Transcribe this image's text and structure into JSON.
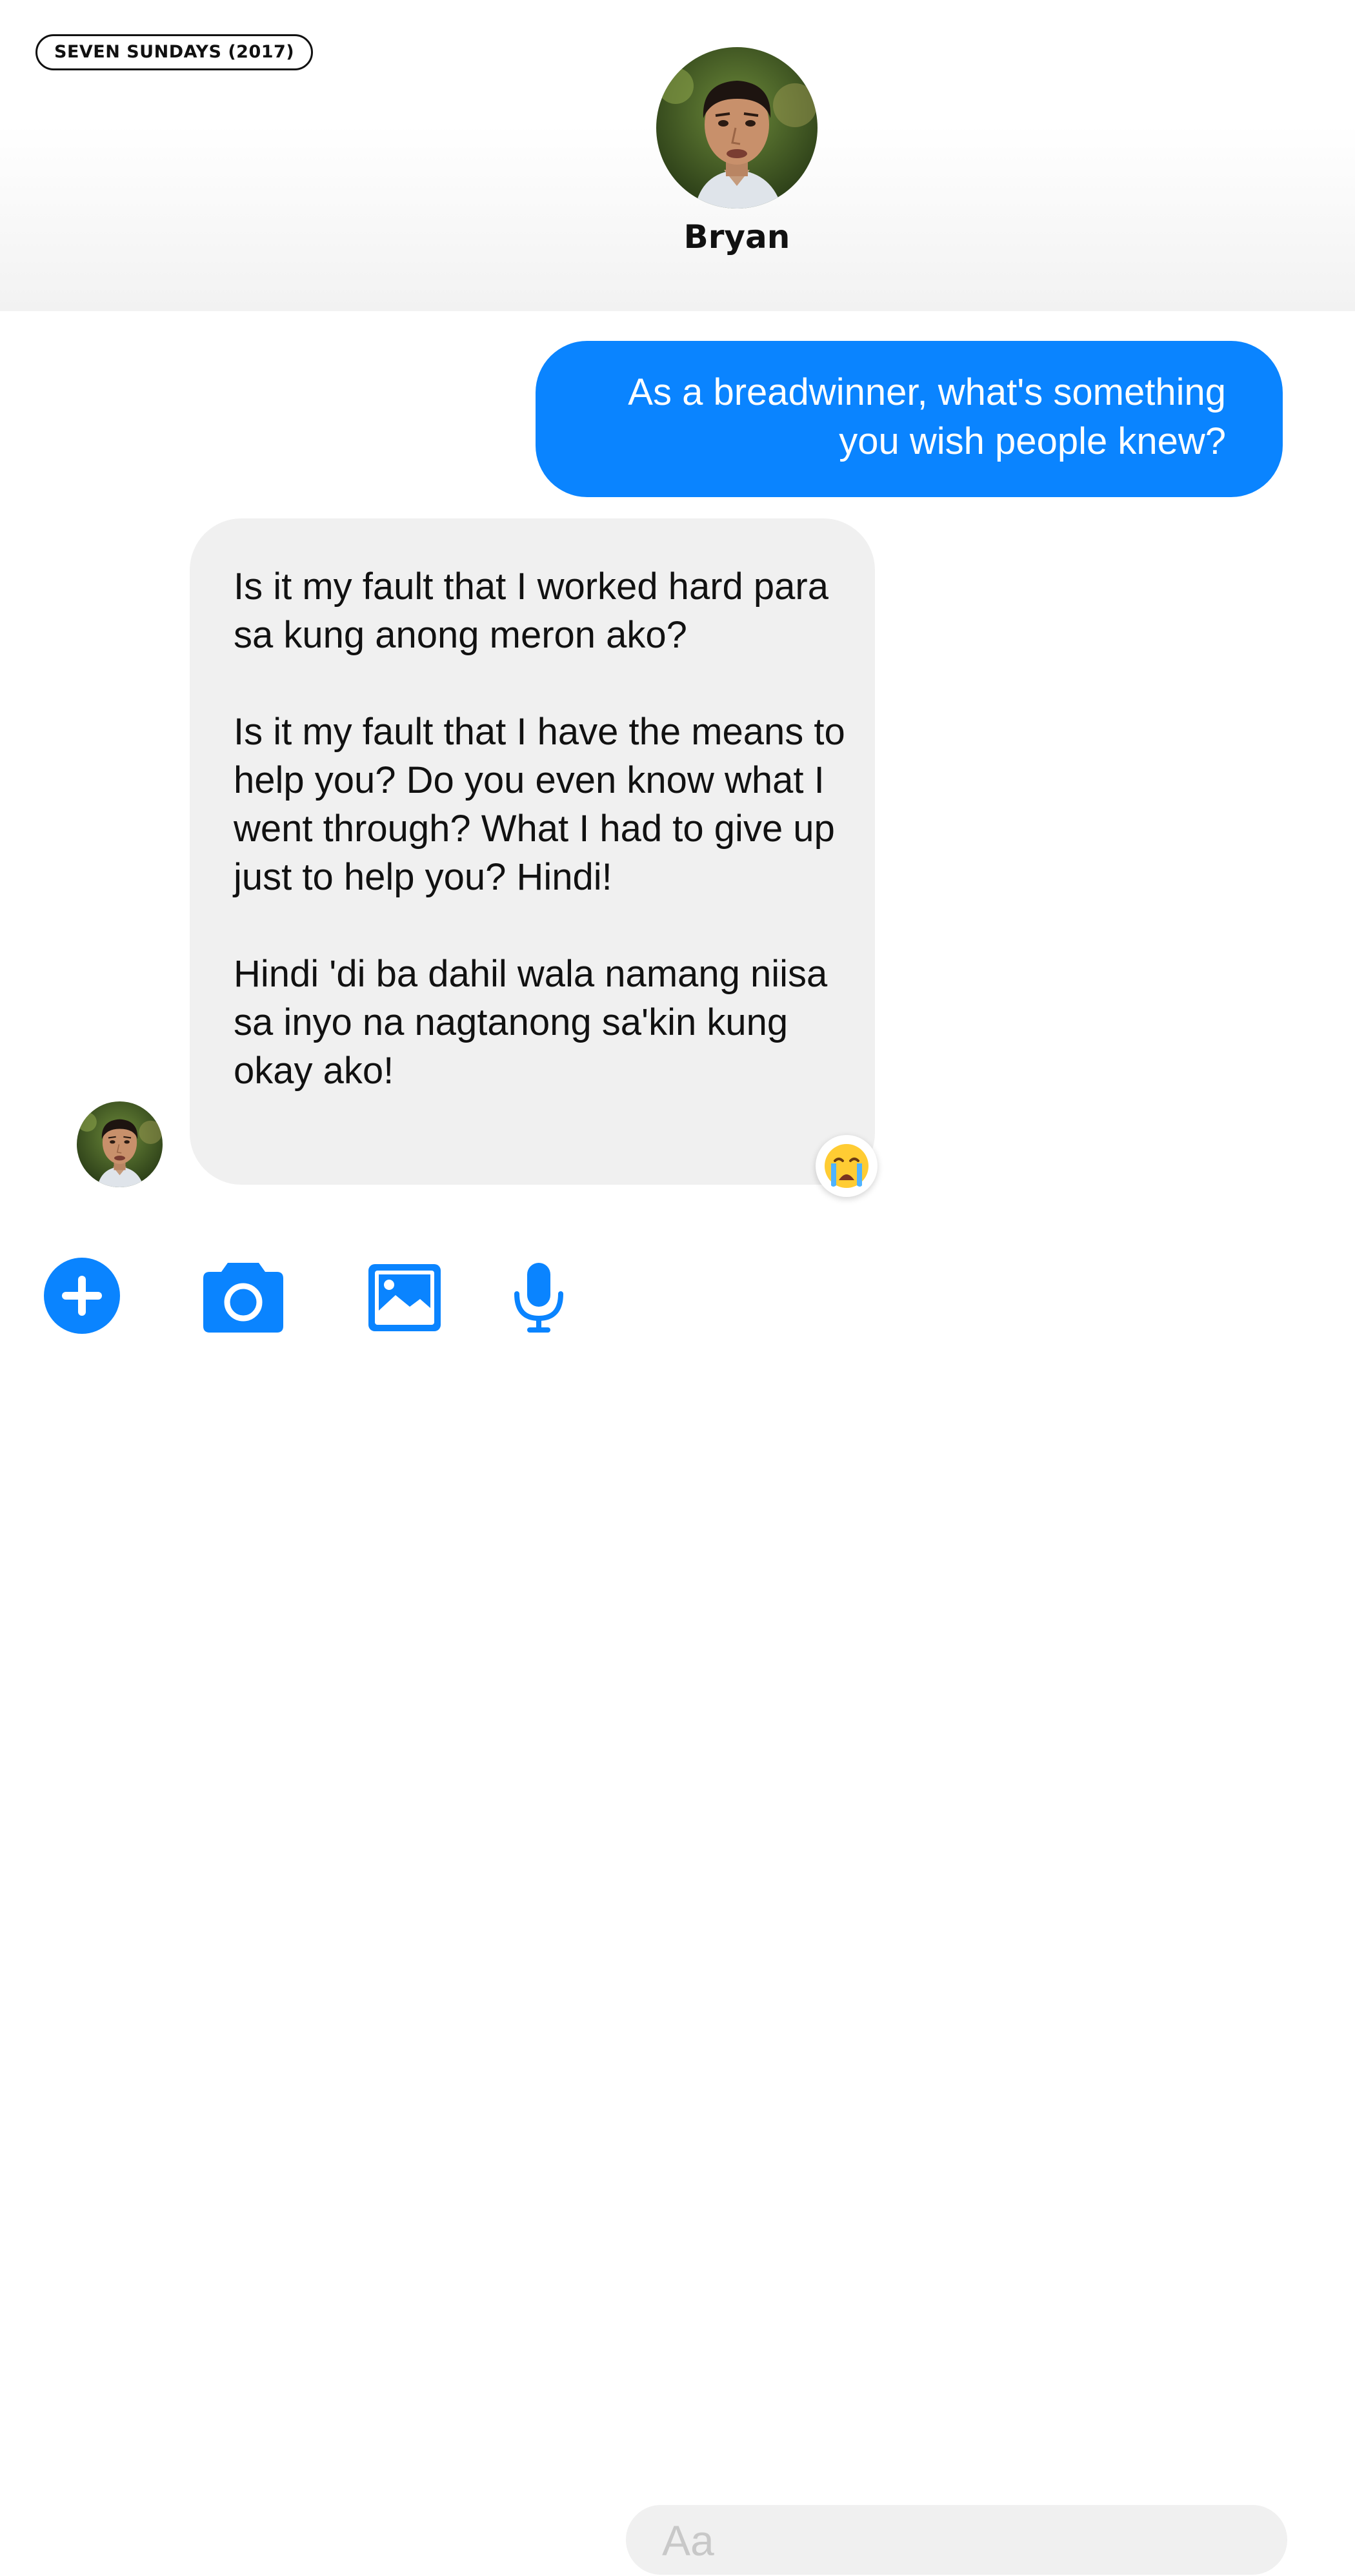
{
  "header": {
    "tag": "SEVEN SUNDAYS (2017)",
    "contact_name": "Bryan"
  },
  "messages": {
    "outgoing": {
      "line1": "As a breadwinner, what's something",
      "line2": "you wish people knew?"
    },
    "incoming": {
      "paragraph1": "Is it my fault that I worked hard para sa kung anong meron ako?",
      "paragraph2": "Is it my fault that I have the means to help you? Do you even know what I went through? What I had to give up just to help you? Hindi!",
      "paragraph3": "Hindi 'di ba dahil wala namang niisa sa inyo na nagtanong sa'kin kung okay ako!",
      "reaction": "crying-face-emoji"
    }
  },
  "composer": {
    "placeholder": "Aa"
  },
  "icons": [
    "plus-circle-icon",
    "camera-icon",
    "image-icon",
    "microphone-icon"
  ],
  "colors": {
    "accent": "#0a84ff",
    "incoming_bubble": "#f0f0f0",
    "outgoing_text": "#ffffff"
  }
}
